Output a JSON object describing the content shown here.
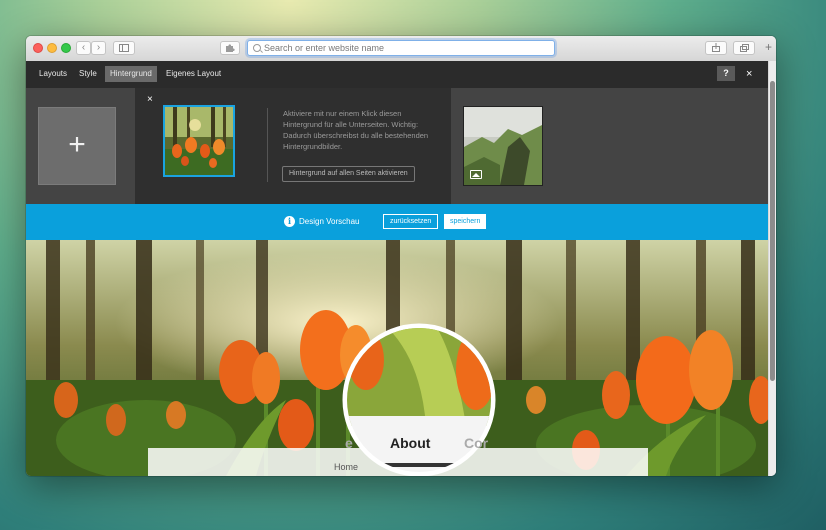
{
  "browser": {
    "url_placeholder": "Search or enter website name"
  },
  "menu": {
    "items": [
      {
        "label": "Layouts"
      },
      {
        "label": "Style"
      },
      {
        "label": "Hintergrund",
        "active": true
      },
      {
        "label": "Eigenes Layout"
      }
    ],
    "help_label": "?",
    "close_label": "×"
  },
  "background_panel": {
    "add_label": "+",
    "close_label": "×",
    "description": "Aktiviere mit nur einem Klick diesen Hintergrund für alle Unterseiten. Wichtig: Dadurch überschreibst du alle bestehenden Hintergrundbilder.",
    "activate_button": "Hintergrund auf allen Seiten aktivieren"
  },
  "preview_bar": {
    "info_icon": "i",
    "label": "Design Vorschau",
    "reset_button": "zurücksetzen",
    "save_button": "speichern"
  },
  "site_nav": {
    "home": "Home",
    "about": "About",
    "partial_left": "e",
    "partial_right": "Cor"
  },
  "colors": {
    "accent_blue": "#0aa0dc",
    "menu_bg": "#2b2b2b",
    "panel_bg": "#444444"
  }
}
